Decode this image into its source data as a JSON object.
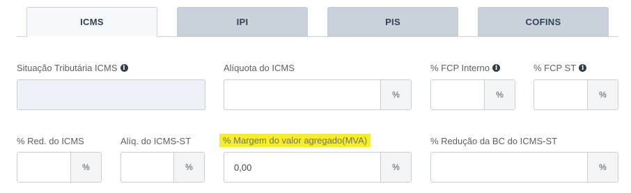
{
  "tabs": [
    {
      "label": "ICMS",
      "active": true
    },
    {
      "label": "IPI",
      "active": false
    },
    {
      "label": "PIS",
      "active": false
    },
    {
      "label": "COFINS",
      "active": false
    }
  ],
  "row1": {
    "situacao_label": "Situação Tributária ICMS",
    "situacao_value": "",
    "aliquota_label": "Alíquota do ICMS",
    "aliquota_value": "",
    "fcp_interno_label": "% FCP Interno",
    "fcp_interno_value": "",
    "fcp_st_label": "% FCP ST",
    "fcp_st_value": ""
  },
  "row2": {
    "red_icms_label": "% Red. do ICMS",
    "red_icms_value": "",
    "aliq_st_label": "Alíq. do ICMS-ST",
    "aliq_st_value": "",
    "mva_label": "% Margem do valor agregado(MVA)",
    "mva_value": "0,00",
    "reducao_bc_label": "% Redução da BC do ICMS-ST",
    "reducao_bc_value": ""
  },
  "suffix": "%",
  "info_glyph": "i",
  "colors": {
    "highlight": "#f6ee2a",
    "tab_active": "#f5f9fc",
    "tab_inactive": "#c9d2db"
  }
}
